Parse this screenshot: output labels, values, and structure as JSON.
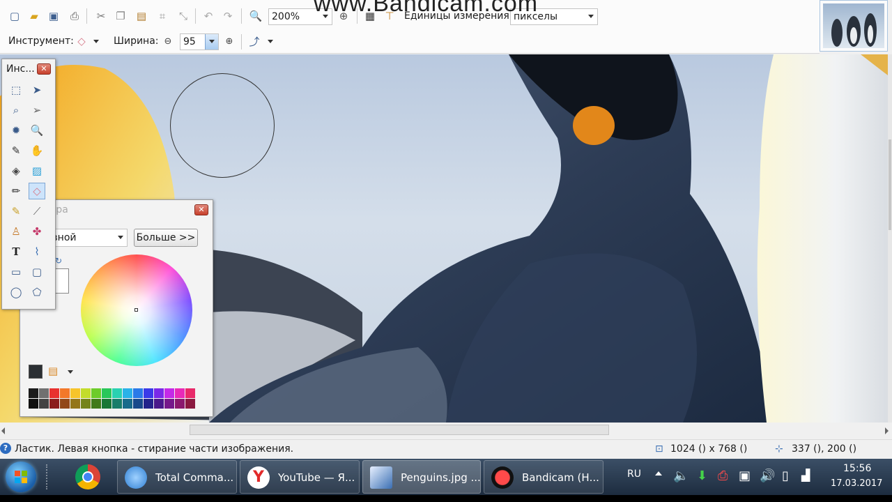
{
  "watermark": "www.Bandicam.com",
  "toolbar": {
    "zoom_value": "200%",
    "units_label": "Единицы измерения:",
    "units_value": "пикселы",
    "tool_label": "Инструмент:",
    "width_label": "Ширина:",
    "width_value": "95"
  },
  "tools_window": {
    "title": "Инс..."
  },
  "palette_window": {
    "title": "Палитра",
    "mode_value": "Основной",
    "more_button": "Больше >>",
    "palette_colors": [
      "#1b1b1b",
      "#707070",
      "#e8312f",
      "#f3782a",
      "#f7c42b",
      "#c3dc2b",
      "#6dcc2a",
      "#29c75a",
      "#2ad1b1",
      "#2ab2e8",
      "#2a7ae8",
      "#3a3ae8",
      "#7a2ae8",
      "#c42ae8",
      "#e82ab8",
      "#e82a6a"
    ]
  },
  "status": {
    "hint": "Ластик. Левая кнопка - стирание части изображения.",
    "image_size": "1024 () x 768 ()",
    "cursor_pos": "337 (), 200 ()"
  },
  "taskbar": {
    "items": [
      {
        "label": "Total Comma...",
        "color": "#2f7fd3"
      },
      {
        "label": "YouTube — Я...",
        "color": "#e22a2a"
      },
      {
        "label": "Penguins.jpg ...",
        "color": "#3a6fb3"
      },
      {
        "label": "Bandicam (Н...",
        "color": "#d81f1f"
      }
    ],
    "lang": "RU",
    "time": "15:56",
    "date": "17.03.2017"
  },
  "colors": {
    "accent": "#3d5f8f",
    "close": "#c7402c"
  }
}
